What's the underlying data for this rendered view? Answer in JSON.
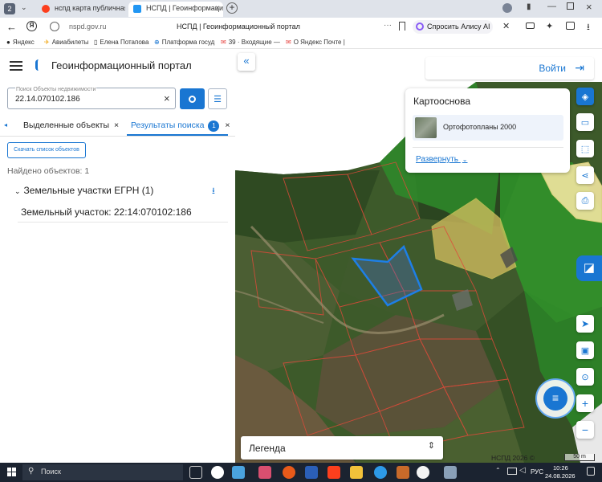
{
  "browser": {
    "tab_count": "2",
    "tabs": [
      {
        "title": "нспд карта публичная ка"
      },
      {
        "title": "НСПД | Геоинформацио"
      }
    ],
    "address": "nspd.gov.ru",
    "page_title": "НСПД | Геоинформационный портал",
    "alice_label": "Спросить Алису AI",
    "bookmarks": [
      "Яндекс",
      "Авиабилеты",
      "Елена Потапова",
      "Платформа госуд",
      "39 · Входящие — ",
      "О Яндекс Почте |"
    ]
  },
  "portal": {
    "title": "Геоинформационный портал",
    "search": {
      "label": "Поиск Объекты недвижимости",
      "value": "22.14.070102.186"
    },
    "tabs": {
      "selected": "Выделенные объекты",
      "results": "Результаты поиска",
      "results_badge": "1"
    },
    "download_list": "Скачать список объектов",
    "found": "Найдено объектов: 1",
    "group": "Земельные участки ЕГРН (1)",
    "item": "Земельный участок: 22:14:070102:186"
  },
  "map": {
    "login": "Войти",
    "basemap_title": "Картооснова",
    "basemap_layer": "Ортофотопланы 2000",
    "expand": "Развернуть",
    "legend": "Легенда",
    "attribution": "НСПД 2026 ©",
    "scale": "50 m"
  },
  "taskbar": {
    "search": "Поиск",
    "lang": "РУС",
    "time": "10:26",
    "date": "24.08.2026"
  }
}
